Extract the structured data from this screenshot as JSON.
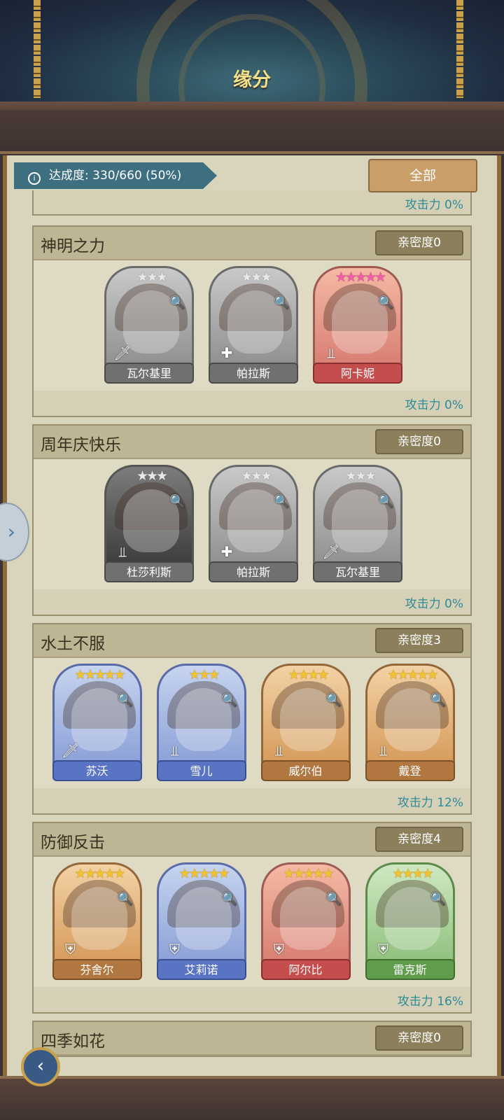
{
  "title": "缘分",
  "progress": {
    "label": "达成度: 330/660 (50%)",
    "achieved": 330,
    "total": 660,
    "percent": 50
  },
  "filter_button": "全部",
  "top_partial": {
    "attack": "攻击力 0%"
  },
  "groups": [
    {
      "title": "神明之力",
      "affinity": "亲密度0",
      "attack": "攻击力 0%",
      "heroes": [
        {
          "name": "瓦尔基里",
          "stars": "★★★",
          "star_color": "silver",
          "frame": "gray",
          "class_icon": "sword-icon"
        },
        {
          "name": "帕拉斯",
          "stars": "★★★",
          "star_color": "silver",
          "frame": "gray",
          "class_icon": "plus-icon"
        },
        {
          "name": "阿卡妮",
          "stars": "★★★★★",
          "star_color": "pink",
          "frame": "pink",
          "class_icon": "bow-icon"
        }
      ]
    },
    {
      "title": "周年庆快乐",
      "affinity": "亲密度0",
      "attack": "攻击力 0%",
      "heroes": [
        {
          "name": "杜莎利斯",
          "stars": "★★★",
          "star_color": "silver",
          "frame": "dark",
          "class_icon": "bow-icon"
        },
        {
          "name": "帕拉斯",
          "stars": "★★★",
          "star_color": "silver",
          "frame": "gray",
          "class_icon": "plus-icon"
        },
        {
          "name": "瓦尔基里",
          "stars": "★★★",
          "star_color": "silver",
          "frame": "gray",
          "class_icon": "sword-icon"
        }
      ]
    },
    {
      "title": "水土不服",
      "affinity": "亲密度3",
      "attack": "攻击力 12%",
      "heroes": [
        {
          "name": "苏沃",
          "stars": "★★★★★",
          "star_color": "gold",
          "frame": "blue",
          "class_icon": "sword-icon"
        },
        {
          "name": "雪儿",
          "stars": "★★★",
          "star_color": "gold",
          "frame": "blue",
          "class_icon": "bow-icon"
        },
        {
          "name": "威尔伯",
          "stars": "★★★★",
          "star_color": "gold",
          "frame": "orange",
          "class_icon": "bow-icon"
        },
        {
          "name": "戴登",
          "stars": "★★★★★",
          "star_color": "gold",
          "frame": "orange",
          "class_icon": "bow-icon"
        }
      ]
    },
    {
      "title": "防御反击",
      "affinity": "亲密度4",
      "attack": "攻击力 16%",
      "heroes": [
        {
          "name": "芬舍尔",
          "stars": "★★★★★",
          "star_color": "gold",
          "frame": "orange",
          "class_icon": "shield-icon"
        },
        {
          "name": "艾莉诺",
          "stars": "★★★★★",
          "star_color": "gold",
          "frame": "blue",
          "class_icon": "shield-icon"
        },
        {
          "name": "阿尔比",
          "stars": "★★★★★",
          "star_color": "gold",
          "frame": "pink",
          "class_icon": "shield-icon"
        },
        {
          "name": "雷克斯",
          "stars": "★★★★",
          "star_color": "gold",
          "frame": "green",
          "class_icon": "shield-icon"
        }
      ]
    },
    {
      "title": "四季如花",
      "affinity": "亲密度0",
      "heroes": []
    }
  ]
}
